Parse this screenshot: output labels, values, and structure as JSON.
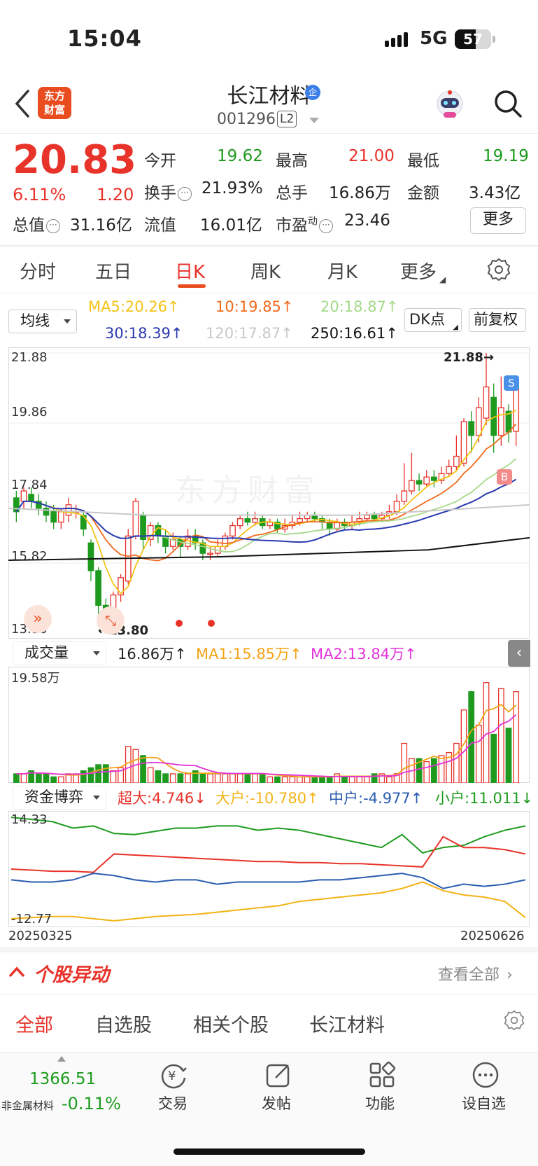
{
  "status": {
    "time": "15:04",
    "network": "5G",
    "battery": "57"
  },
  "header": {
    "logo": "东方财富",
    "name": "长江材料",
    "badge": "企",
    "code": "001296",
    "level": "L2"
  },
  "quote": {
    "price": "20.83",
    "change_pct": "6.11%",
    "change": "1.20",
    "open_label": "今开",
    "open": "19.62",
    "high_label": "最高",
    "high": "21.00",
    "low_label": "最低",
    "low": "19.19",
    "turnover_label": "换手",
    "turnover": "21.93%",
    "volume_label": "总手",
    "volume": "16.86万",
    "amount_label": "金额",
    "amount": "3.43亿",
    "mcap_label": "总值",
    "mcap": "31.16亿",
    "float_label": "流值",
    "float": "16.01亿",
    "pe_label": "市盈",
    "pe_sup": "动",
    "pe": "23.46",
    "more": "更多"
  },
  "tabs": [
    "分时",
    "五日",
    "日K",
    "周K",
    "月K",
    "更多"
  ],
  "ma": {
    "select": "均线",
    "ma5": "MA5:20.26↑",
    "ma10": "10:19.85↑",
    "ma20": "20:18.87↑",
    "ma30": "30:18.39↑",
    "ma120": "120:17.87↑",
    "ma250": "250:16.61↑",
    "dk": "DK点",
    "adjust": "前复权"
  },
  "kline": {
    "y_labels": [
      "21.88",
      "19.86",
      "17.84",
      "15.82",
      "13.80"
    ],
    "max_label": "21.88→",
    "min_label": "←13.80",
    "watermark": "东方财富",
    "sell_mark": "S",
    "buy_mark": "B"
  },
  "volume": {
    "select": "成交量",
    "value": "16.86万↑",
    "ma1": "MA1:15.85万↑",
    "ma2": "MA2:13.84万↑",
    "max_label": "19.58万"
  },
  "fund": {
    "select": "资金博弈",
    "super": "超大:4.746↓",
    "big": "大户:-10.780↑",
    "mid": "中户:-4.977↑",
    "small": "小户:11.011↓",
    "top_label": "14.33",
    "bottom_label": "-12.77",
    "date_start": "20250325",
    "date_end": "20250626"
  },
  "news": {
    "title": "个股异动",
    "more": "查看全部",
    "tabs": [
      "全部",
      "自选股",
      "相关个股",
      "长江材料"
    ]
  },
  "bottom": {
    "index_value": "1366.51",
    "index_name": "非金属材料",
    "index_change": "-0.11%",
    "items": [
      "交易",
      "发帖",
      "功能",
      "设自选"
    ]
  },
  "colors": {
    "up": "#e8332a",
    "down": "#1e9b1e",
    "ma5": "#f3c316",
    "ma10": "#f06a1c",
    "ma20": "#a6d98a",
    "ma30": "#2a3ab0",
    "ma120": "#c8c8c8",
    "ma250": "#111111"
  }
}
